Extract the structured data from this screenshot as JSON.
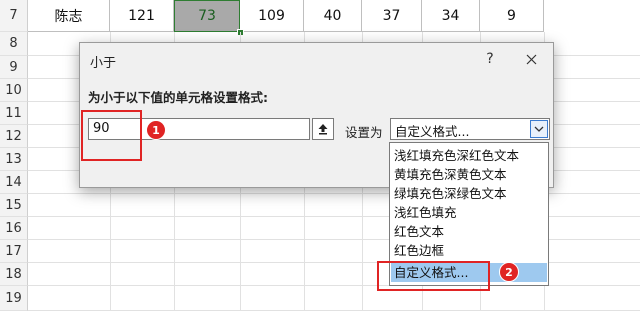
{
  "sheet": {
    "row7": {
      "header": "7",
      "cells": [
        "陈志",
        "121",
        "73",
        "109",
        "40",
        "37",
        "34",
        "9"
      ]
    },
    "row_headers": [
      "8",
      "9",
      "10",
      "11",
      "12",
      "13",
      "14",
      "15",
      "16",
      "17",
      "18",
      "19"
    ]
  },
  "dialog": {
    "title": "小于",
    "help": "?",
    "instruction": "为小于以下值的单元格设置格式:",
    "value": "90",
    "set_label": "设置为",
    "selected_format": "自定义格式..."
  },
  "dropdown": {
    "options": [
      "浅红填充色深红色文本",
      "黄填充色深黄色文本",
      "绿填充色深绿色文本",
      "浅红色填充",
      "红色文本",
      "红色边框",
      "自定义格式..."
    ],
    "highlighted_index": 6
  },
  "annotations": {
    "badge1": "1",
    "badge2": "2"
  },
  "colors": {
    "annotation_red": "#e02424",
    "highlight_blue": "#9ec9ef",
    "selected_cell": "#a9a9a9"
  }
}
